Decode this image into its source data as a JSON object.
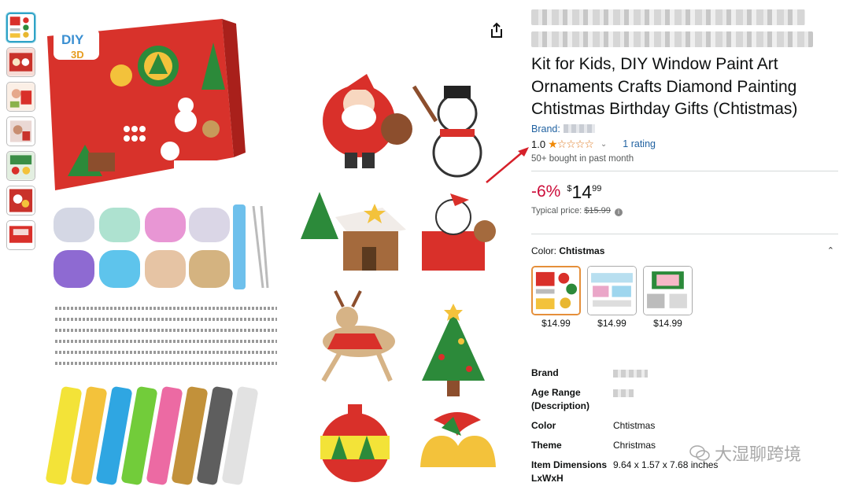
{
  "product": {
    "title_line1_blur": "",
    "title": "Kit for Kids, DIY Window Paint Art Ornaments Crafts Diamond Painting Chtistmas Birthday Gifts (Chtistmas)",
    "brand_label": "Brand:",
    "rating_value": "1.0",
    "rating_stars": 1,
    "rating_count": "1 rating",
    "bought": "50+ bought in past month",
    "discount": "-6%",
    "currency": "$",
    "price_whole": "14",
    "price_fraction": "99",
    "typical_label": "Typical price:",
    "typical_price": "$15.99",
    "color_label": "Color:",
    "color_value": "Chtistmas",
    "swatches": [
      {
        "price": "$14.99",
        "selected": true
      },
      {
        "price": "$14.99",
        "selected": false
      },
      {
        "price": "$14.99",
        "selected": false
      }
    ]
  },
  "specs": [
    {
      "key": "Brand",
      "value": ""
    },
    {
      "key": "Age Range (Description)",
      "value": ""
    },
    {
      "key": "Color",
      "value": "Chtistmas"
    },
    {
      "key": "Theme",
      "value": "Christmas"
    },
    {
      "key": "Item Dimensions LxWxH",
      "value": "9.64 x 1.57 x 7.68 inches"
    }
  ],
  "image": {
    "box_logo": "DIY",
    "box_subtitle": "3D"
  },
  "watermark": "大湿聊跨境",
  "colors": {
    "link": "#2162a1",
    "discount": "#cc0c39",
    "star": "#de7921",
    "swatch_selected": "#e58f3a",
    "arrow": "#d6202a"
  }
}
